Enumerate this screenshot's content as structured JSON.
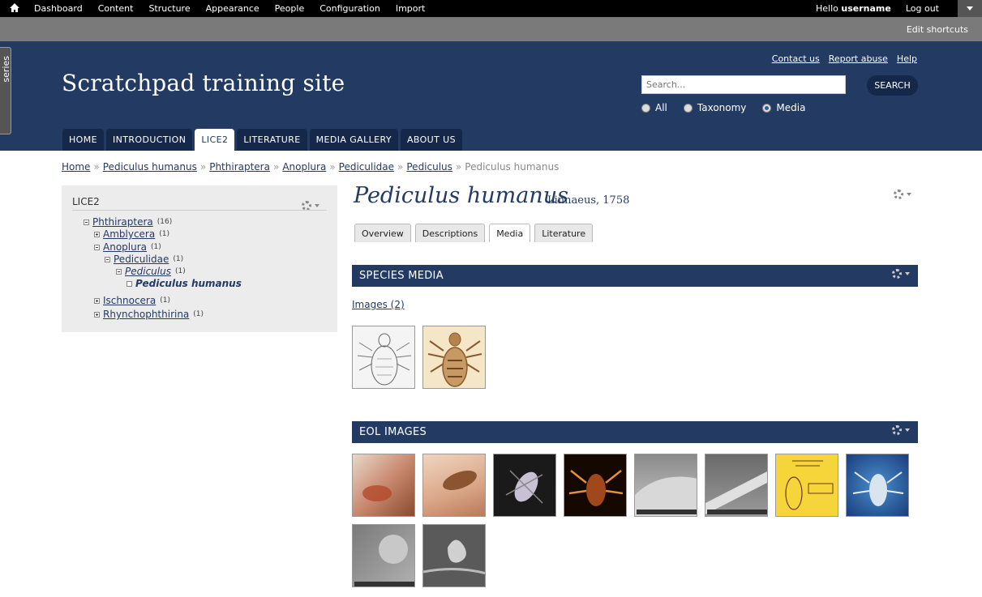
{
  "admin_bar": {
    "menu": [
      "Dashboard",
      "Content",
      "Structure",
      "Appearance",
      "People",
      "Configuration",
      "Import"
    ],
    "hello": "Hello",
    "username": "username",
    "logout": "Log out"
  },
  "shortcut_bar": {
    "edit_shortcuts": "Edit shortcuts"
  },
  "side_tab": {
    "label": "series"
  },
  "header": {
    "site_name": "Scratchpad training site",
    "top_links": [
      "Contact us",
      "Report abuse",
      "Help"
    ],
    "search": {
      "placeholder": "Search...",
      "button": "SEARCH"
    },
    "radios": [
      {
        "label": "All",
        "checked": false
      },
      {
        "label": "Taxonomy",
        "checked": false
      },
      {
        "label": "Media",
        "checked": true
      }
    ],
    "tabs": [
      "HOME",
      "INTRODUCTION",
      "LICE2",
      "LITERATURE",
      "MEDIA GALLERY",
      "ABOUT US"
    ],
    "active_tab": "LICE2"
  },
  "breadcrumb": {
    "links": [
      "Home",
      "Pediculus humanus",
      "Phthiraptera",
      "Anoplura",
      "Pediculidae",
      "Pediculus"
    ],
    "separator": "»",
    "current": "Pediculus humanus"
  },
  "sidebar": {
    "title": "LICE2",
    "tree": [
      {
        "label": "Phthiraptera",
        "count": "(16)"
      },
      {
        "label": "Amblycera",
        "count": "(1)"
      },
      {
        "label": "Anoplura",
        "count": "(1)"
      },
      {
        "label": "Pediculidae",
        "count": "(1)"
      },
      {
        "label": "Pediculus",
        "count": "(1)"
      },
      {
        "label": "Pediculus humanus",
        "count": ""
      },
      {
        "label": "Ischnocera",
        "count": "(1)"
      },
      {
        "label": "Rhynchophthirina",
        "count": "(1)"
      }
    ]
  },
  "main": {
    "species": "Pediculus humanus",
    "author": "Linnaeus, 1758",
    "subtabs": [
      "Overview",
      "Descriptions",
      "Media",
      "Literature"
    ],
    "active_subtab": "Media",
    "species_media": {
      "title": "SPECIES MEDIA",
      "images_link": "Images (2)"
    },
    "eol_images": {
      "title": "EOL IMAGES"
    }
  }
}
